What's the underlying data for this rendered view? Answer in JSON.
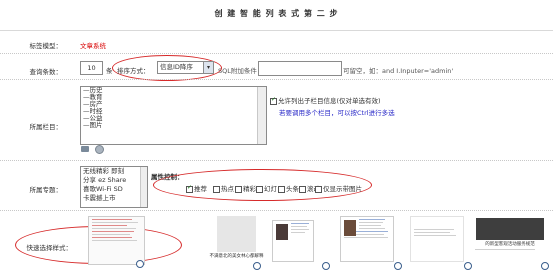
{
  "page": {
    "title": "创 建 智 能 列 表 式 第 二 步"
  },
  "row_label_model": {
    "label": "标签模型：",
    "value": "文章系统"
  },
  "row_count": {
    "label": "查询条数：",
    "value": "10",
    "unit": "条",
    "sort_label": "排序方式：",
    "sort_selected": "信息ID降序",
    "extra_label": "SQL附加条件：",
    "extra_value": "",
    "hint": "可留空，如：and I.Inputer='admin'"
  },
  "row_channel": {
    "label": "所属栏目：",
    "items": [
      "—历史",
      "—教育",
      "—房产",
      "—时经",
      "—公益",
      "—图片"
    ],
    "include_children_label": "允许列出子栏目信息(仅对单选有效)",
    "multi_hint": "若要调用多个栏目，可以按Ctrl进行多选"
  },
  "row_topic": {
    "label": "所属专题：",
    "items": [
      "无线精彩 即刻",
      "分享 ez Share",
      "喜歌Wi-Fi SD",
      "卡震撼上市"
    ],
    "attr_label": "属性控制：",
    "attrs": [
      {
        "label": "推荐",
        "checked": true
      },
      {
        "label": "热点",
        "checked": false
      },
      {
        "label": "精彩",
        "checked": false
      },
      {
        "label": "幻灯",
        "checked": false
      },
      {
        "label": "头条",
        "checked": false
      },
      {
        "label": "滚动",
        "checked": false
      },
      {
        "label": "仅显示带图片",
        "checked": false
      }
    ]
  },
  "row_style": {
    "label": "快速选择样式：",
    "thumb2_caption": "不满意北的美女林心都解释",
    "thumb6_caption": "的新型客观活动服务规范",
    "selected_index": 0
  },
  "colors": {
    "accent_red": "#d80000",
    "circle_red": "#d62a2a",
    "link_blue": "#2a2ac8"
  }
}
